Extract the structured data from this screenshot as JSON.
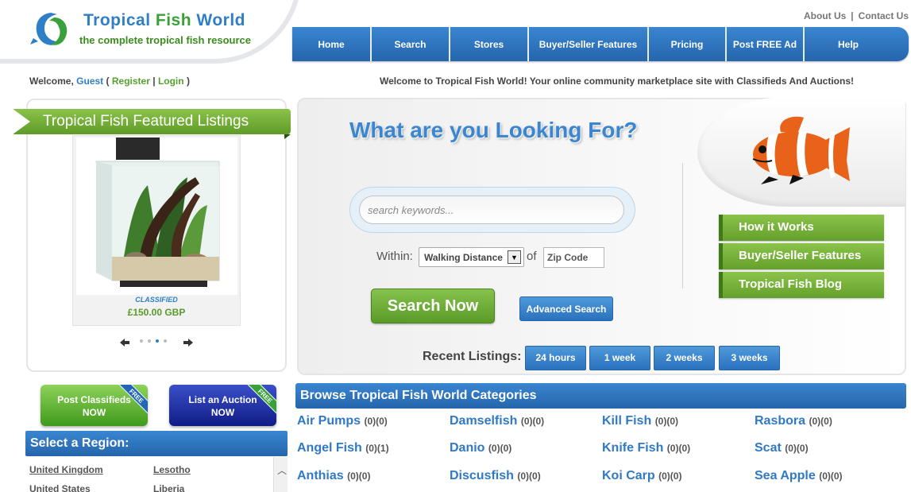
{
  "header": {
    "logo_title_1": "Tropical",
    "logo_title_2": "Fish",
    "logo_title_3": "World",
    "logo_subtitle": "the complete tropical fish resource",
    "toplinks": {
      "about": "About Us",
      "separator": "|",
      "contact": "Contact Us"
    },
    "nav": [
      "Home",
      "Search",
      "Stores",
      "Buyer/Seller Features",
      "Pricing",
      "Post FREE Ad",
      "Help"
    ]
  },
  "welcome": {
    "prefix": "Welcome,",
    "guest": "Guest",
    "open_paren": "(",
    "register": "Register",
    "pipe": "|",
    "login": "Login",
    "close_paren": ")",
    "message": "Welcome to Tropical Fish World! Your online community marketplace site with Classifieds And Auctions!"
  },
  "featured": {
    "title": "Tropical Fish Featured Listings",
    "listing_type": "CLASSIFIED",
    "listing_price": "£150.00 GBP",
    "carousel_dots": 4,
    "active_dot": 3
  },
  "left_buttons": {
    "post_classifieds_1": "Post Classifieds",
    "post_classifieds_2": "NOW",
    "list_auction_1": "List an Auction",
    "list_auction_2": "NOW",
    "free_tag": "FREE"
  },
  "region": {
    "title": "Select a Region:",
    "items": [
      "United Kingdom",
      "Lesotho",
      "United States",
      "Liberia"
    ]
  },
  "search": {
    "title": "What are you Looking For?",
    "placeholder": "search keywords...",
    "within_label": "Within:",
    "within_value": "Walking Distance",
    "of_label": "of",
    "zip_placeholder": "Zip Code",
    "search_button": "Search Now",
    "advanced_button": "Advanced Search",
    "recent_label": "Recent Listings:",
    "recent_options": [
      "24 hours",
      "1 week",
      "2 weeks",
      "3 weeks"
    ]
  },
  "side_links": [
    "How it Works",
    "Buyer/Seller Features",
    "Tropical Fish Blog"
  ],
  "categories": {
    "title": "Browse Tropical Fish World Categories",
    "items": [
      {
        "name": "Air Pumps",
        "count": "(0)(0)"
      },
      {
        "name": "Damselfish",
        "count": "(0)(0)"
      },
      {
        "name": "Kill Fish",
        "count": "(0)(0)"
      },
      {
        "name": "Rasbora",
        "count": "(0)(0)"
      },
      {
        "name": "Angel Fish",
        "count": "(0)(1)"
      },
      {
        "name": "Danio",
        "count": "(0)(0)"
      },
      {
        "name": "Knife Fish",
        "count": "(0)(0)"
      },
      {
        "name": "Scat",
        "count": "(0)(0)"
      },
      {
        "name": "Anthias",
        "count": "(0)(0)"
      },
      {
        "name": "Discusfish",
        "count": "(0)(0)"
      },
      {
        "name": "Koi Carp",
        "count": "(0)(0)"
      },
      {
        "name": "Sea Apple",
        "count": "(0)(0)"
      }
    ]
  },
  "colors": {
    "brand_blue": "#2f7fc6",
    "brand_green": "#5a9a2a",
    "nav_blue": "#2565ad"
  }
}
